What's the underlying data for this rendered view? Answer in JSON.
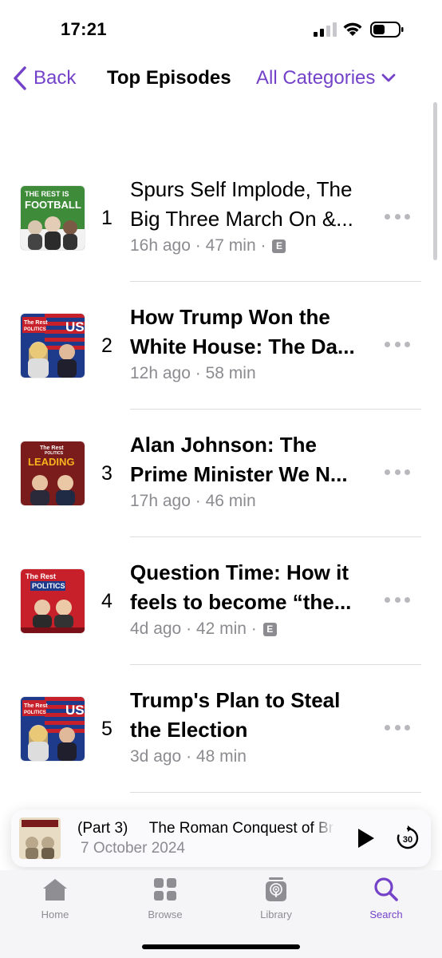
{
  "status_bar": {
    "time": "17:21"
  },
  "nav": {
    "back_label": "Back",
    "title": "Top Episodes",
    "category_label": "All Categories"
  },
  "episodes": [
    {
      "rank": "1",
      "title_line1": "Spurs Self Implode, The",
      "title_line2": "Big Three March On &...",
      "bold": false,
      "age": "16h ago",
      "duration": "47 min",
      "explicit": true,
      "explicit_label": "E",
      "art": {
        "top_text": "THE REST IS",
        "main_text": "FOOTBALL",
        "bg": "#3e8b3a"
      }
    },
    {
      "rank": "2",
      "title_line1": "How Trump Won the",
      "title_line2": "White House: The Da...",
      "bold": true,
      "age": "12h ago",
      "duration": "58 min",
      "explicit": false,
      "art": {
        "top_text": "The Rest",
        "main_text": "POLITICS",
        "badge": "US",
        "bg": "#1e3a8a"
      }
    },
    {
      "rank": "3",
      "title_line1": "Alan Johnson: The",
      "title_line2": "Prime Minister We N...",
      "bold": true,
      "age": "17h ago",
      "duration": "46 min",
      "explicit": false,
      "art": {
        "top_text": "The Rest",
        "sub_text": "POLITICS",
        "main_text": "LEADING",
        "bg": "#7a1c1c"
      }
    },
    {
      "rank": "4",
      "title_line1": "Question Time: How it",
      "title_line2": "feels to become “the...",
      "bold": true,
      "age": "4d ago",
      "duration": "42 min",
      "explicit": true,
      "explicit_label": "E",
      "art": {
        "top_text": "The Rest",
        "main_text": "POLITICS",
        "bg": "#c8202a"
      }
    },
    {
      "rank": "5",
      "title_line1": "Trump's Plan to Steal",
      "title_line2": "the Election",
      "bold": true,
      "age": "3d ago",
      "duration": "48 min",
      "explicit": false,
      "art": {
        "top_text": "The Rest",
        "main_text": "POLITICS",
        "badge": "US",
        "bg": "#1e3a8a"
      }
    }
  ],
  "mini_player": {
    "part": "(Part 3)",
    "title": "The Roman Conquest of Br",
    "date": "7 October 2024",
    "skip_label": "30"
  },
  "tabs": [
    {
      "label": "Home",
      "icon": "home-icon",
      "active": false
    },
    {
      "label": "Browse",
      "icon": "browse-grid-icon",
      "active": false
    },
    {
      "label": "Library",
      "icon": "library-podcast-icon",
      "active": false
    },
    {
      "label": "Search",
      "icon": "search-icon",
      "active": true
    }
  ],
  "colors": {
    "accent": "#7442c8",
    "secondary_text": "#8b8b90",
    "divider": "#dcdce0"
  }
}
